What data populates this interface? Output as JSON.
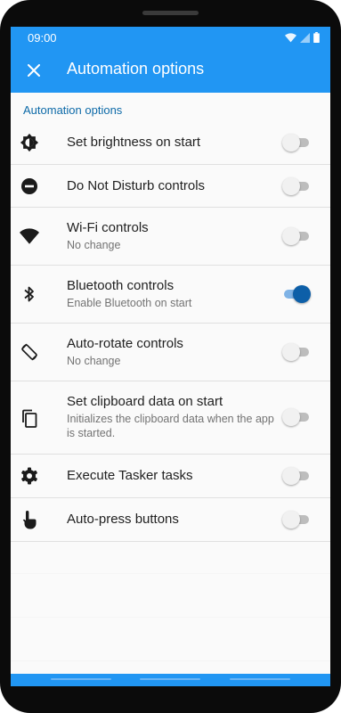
{
  "status_bar": {
    "time": "09:00",
    "color": "#2196f3"
  },
  "app_bar": {
    "title": "Automation options",
    "close_icon": "close-icon"
  },
  "section_header": "Automation options",
  "items": [
    {
      "label": "Set brightness on start",
      "sub": "",
      "icon": "brightness-icon",
      "enabled": false
    },
    {
      "label": "Do Not Disturb controls",
      "sub": "",
      "icon": "do-not-disturb-icon",
      "enabled": false
    },
    {
      "label": "Wi-Fi controls",
      "sub": "No change",
      "icon": "wifi-icon",
      "enabled": false
    },
    {
      "label": "Bluetooth controls",
      "sub": "Enable Bluetooth on start",
      "icon": "bluetooth-icon",
      "enabled": true
    },
    {
      "label": "Auto-rotate controls",
      "sub": "No change",
      "icon": "screen-rotation-icon",
      "enabled": false
    },
    {
      "label": "Set clipboard data on start",
      "sub": "Initializes the clipboard data when the app is started.",
      "icon": "clipboard-icon",
      "enabled": false
    },
    {
      "label": "Execute Tasker tasks",
      "sub": "",
      "icon": "gear-icon",
      "enabled": false
    },
    {
      "label": "Auto-press buttons",
      "sub": "",
      "icon": "touch-icon",
      "enabled": false
    }
  ],
  "colors": {
    "accent": "#2196f3",
    "toggle_on": "#0d5fa8",
    "section_header": "#0d6aa8"
  }
}
